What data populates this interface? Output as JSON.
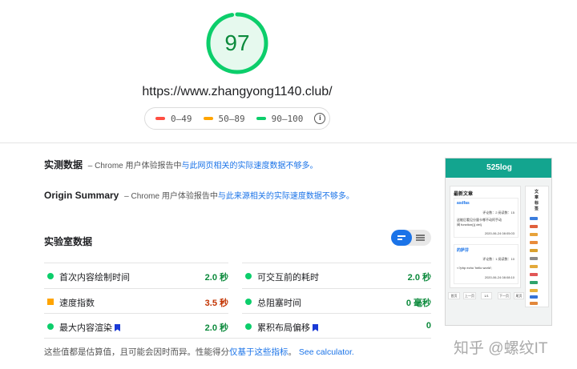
{
  "summary": {
    "score": 97,
    "score_fraction": 0.97,
    "score_color": "#0cce6b",
    "url": "https://www.zhangyong1140.club/"
  },
  "legend": {
    "items": [
      {
        "label": "0–49",
        "color": "#ff4e42"
      },
      {
        "label": "50–89",
        "color": "#ffa400"
      },
      {
        "label": "90–100",
        "color": "#0cce6b"
      }
    ],
    "info_icon": "info-icon"
  },
  "field_data": {
    "title": "实测数据",
    "dash": "–",
    "prefix": "Chrome 用户体验报告中",
    "link": "与此网页相关的实际速度数据不够多。"
  },
  "origin_summary": {
    "title": "Origin Summary",
    "dash": "–",
    "prefix": "Chrome 用户体验报告中",
    "link": "与此来源相关的实际速度数据不够多。"
  },
  "lab": {
    "title": "实验室数据",
    "toggle_icon": "list-view-toggle-icon",
    "metrics": [
      {
        "label": "首次内容绘制时间",
        "value": "2.0 秒",
        "status": "pass",
        "color": "#0cce6b",
        "value_color": "#0c8a3c",
        "bookmark": false
      },
      {
        "label": "可交互前的耗时",
        "value": "2.0 秒",
        "status": "pass",
        "color": "#0cce6b",
        "value_color": "#0c8a3c",
        "bookmark": false
      },
      {
        "label": "速度指数",
        "value": "3.5 秒",
        "status": "average",
        "color": "#ffa400",
        "value_color": "#c33300",
        "bookmark": false
      },
      {
        "label": "总阻塞时间",
        "value": "0 毫秒",
        "status": "pass",
        "color": "#0cce6b",
        "value_color": "#0c8a3c",
        "bookmark": false
      },
      {
        "label": "最大内容渲染",
        "value": "2.0 秒",
        "status": "pass",
        "color": "#0cce6b",
        "value_color": "#0c8a3c",
        "bookmark": true
      },
      {
        "label": "累积布局偏移",
        "value": "0",
        "status": "pass",
        "color": "#0cce6b",
        "value_color": "#0c8a3c",
        "bookmark": true
      }
    ],
    "footnote_text": "这些值都是估算值，且可能会因时而异。性能得分",
    "footnote_link1": "仅基于这些指标",
    "footnote_sep": "。",
    "footnote_link2": "See calculator."
  },
  "thumbnail": {
    "site_title": "525log",
    "section_title": "最新文章",
    "post1": {
      "title": "asdfas",
      "meta": "评论数：2  阅读数：15",
      "line1": "这能后看见分量卡哪不动阿手动",
      "line2": "阀 function(){ del}",
      "date": "2020-06-24 08:05:03"
    },
    "post2": {
      "title": "的萨芬",
      "meta": "评论数：1  阅读数：10",
      "line1": "<?php echo 'hello world';",
      "date": "2020-06-24 08:08:10"
    },
    "side_title": "文章标签",
    "pager": [
      "首页",
      "上一页",
      "1/1",
      "下一页",
      "尾页"
    ]
  },
  "watermark": "知乎 @螺纹IT"
}
